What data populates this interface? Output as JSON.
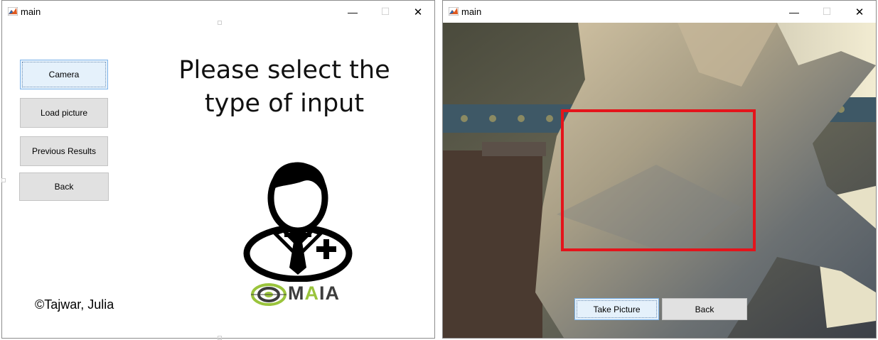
{
  "left_window": {
    "title": "main",
    "controls": {
      "minimize": "—",
      "maximize": "☐",
      "close": "✕"
    },
    "buttons": {
      "camera": "Camera",
      "load_picture": "Load picture",
      "previous_results": "Previous Results",
      "back": "Back"
    },
    "prompt_line1": "Please select the",
    "prompt_line2": "type of input",
    "copyright": "©Tajwar, Julia",
    "logo": {
      "text_m": "M",
      "text_a1": "A",
      "text_i": "I",
      "text_a2": "A",
      "color_dark": "#3d3d3d",
      "color_green": "#9ac43c"
    }
  },
  "right_window": {
    "title": "main",
    "controls": {
      "minimize": "—",
      "maximize": "☐",
      "close": "✕"
    },
    "buttons": {
      "take_picture": "Take Picture",
      "back": "Back"
    },
    "overlay_color": "#e4141b"
  }
}
